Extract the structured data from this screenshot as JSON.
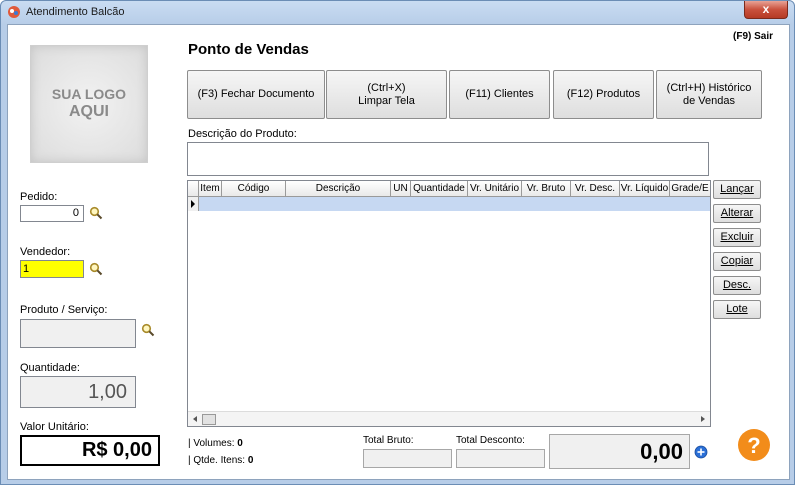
{
  "window": {
    "title": "Atendimento Balcão",
    "close_label": "x"
  },
  "logo": {
    "line1": "SUA LOGO",
    "line2": "AQUI"
  },
  "header": {
    "title": "Ponto de Vendas",
    "exit_label": "(F9) Sair"
  },
  "toolbar": {
    "fechar_documento": "(F3) Fechar Documento",
    "limpar_tela_line1": "(Ctrl+X)",
    "limpar_tela_line2": "Limpar Tela",
    "clientes": "(F11) Clientes",
    "produtos": "(F12) Produtos",
    "historico_line1": "(Ctrl+H) Histórico",
    "historico_line2": "de Vendas"
  },
  "left_panel": {
    "pedido_label": "Pedido:",
    "pedido_value": "0",
    "vendedor_label": "Vendedor:",
    "vendedor_value": "1",
    "produto_label": "Produto / Serviço:",
    "produto_value": "",
    "quantidade_label": "Quantidade:",
    "quantidade_value": "1,00",
    "valor_label": "Valor Unitário:",
    "valor_value": "R$ 0,00"
  },
  "descricao": {
    "label": "Descrição do Produto:",
    "value": ""
  },
  "grid": {
    "columns": [
      "Item",
      "Código",
      "Descrição",
      "UN",
      "Quantidade",
      "Vr. Unitário",
      "Vr. Bruto",
      "Vr. Desc.",
      "Vr. Líquido",
      "Grade/E"
    ],
    "rows": []
  },
  "side_buttons": [
    "Lançar",
    "Alterar",
    "Excluir",
    "Copiar",
    "Desc.",
    "Lote"
  ],
  "footer": {
    "volumes_label": "| Volumes:",
    "volumes_value": "0",
    "itens_label": "| Qtde. Itens:",
    "itens_value": "0",
    "total_bruto_label": "Total Bruto:",
    "total_bruto_value": "",
    "total_desconto_label": "Total Desconto:",
    "total_desconto_value": "",
    "total_value": "0,00"
  },
  "colors": {
    "vendedor_field": "#ffff00",
    "accent_blue": "#2a6fd6",
    "help_orange": "#f28c1a"
  },
  "icons": [
    "app-icon",
    "search-icon",
    "plus-circle-icon",
    "help-icon",
    "row-pointer-icon"
  ]
}
